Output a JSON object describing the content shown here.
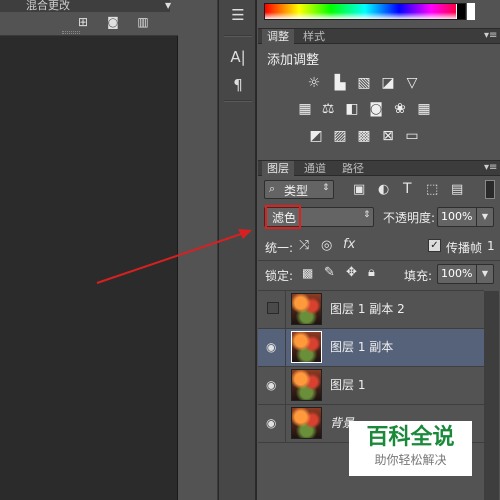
{
  "left_panel": {
    "title": "混合更改",
    "icons": [
      "new-layer-icon",
      "camera-icon",
      "trash-icon"
    ]
  },
  "adjustments": {
    "tabs": [
      "调整",
      "样式"
    ],
    "heading": "添加调整"
  },
  "layers_panel": {
    "tabs": [
      "图层",
      "通道",
      "路径"
    ],
    "filter_label": "类型",
    "blend_mode": "滤色",
    "opacity_label": "不透明度:",
    "opacity_value": "100%",
    "unify_label": "统一:",
    "propagate_label": "传播帧",
    "propagate_value": "1",
    "lock_label": "锁定:",
    "fill_label": "填充:",
    "fill_value": "100%",
    "layers": [
      {
        "name": "图层 1 副本 2",
        "visible": false,
        "selected": false
      },
      {
        "name": "图层 1 副本",
        "visible": true,
        "selected": true
      },
      {
        "name": "图层 1",
        "visible": true,
        "selected": false
      },
      {
        "name": "背景",
        "visible": true,
        "selected": false
      }
    ]
  },
  "watermark": {
    "title": "百科全说",
    "subtitle": "助你轻松解决"
  },
  "colors": {
    "highlight_box": "#e0201c",
    "arrow": "#d82020",
    "selected_row": "#56627a"
  }
}
